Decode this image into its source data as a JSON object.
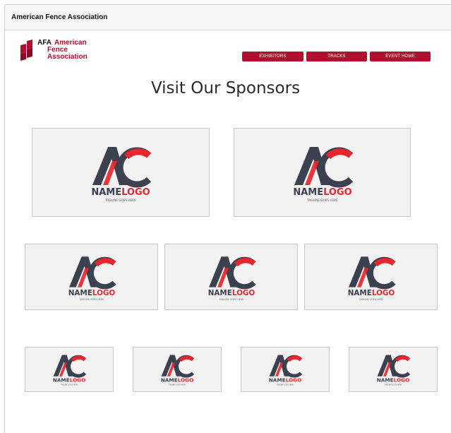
{
  "window": {
    "title": "American Fence Association"
  },
  "logo": {
    "abbrev": "AFA",
    "line1": "American",
    "line2": "Fence",
    "line3": "Association"
  },
  "nav": [
    {
      "label": "EXHIBITORS"
    },
    {
      "label": "TRACKS"
    },
    {
      "label": "EVENT HOME"
    }
  ],
  "heading": "Visit Our Sponsors",
  "sponsor_logo": {
    "word1": "NAME",
    "word2": "LOGO",
    "tagline": "TAGLINE GOES HERE"
  },
  "colors": {
    "brand_red": "#b10f2e",
    "logo_dark": "#3c4150",
    "logo_red": "#e8262e"
  }
}
